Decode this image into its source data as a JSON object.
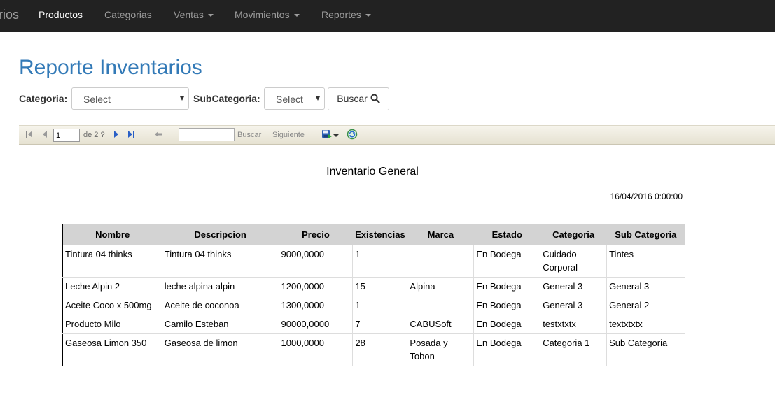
{
  "navbar": {
    "brand_fragment": "rios",
    "items": [
      {
        "label": "Productos",
        "active": true,
        "dropdown": false
      },
      {
        "label": "Categorias",
        "active": false,
        "dropdown": false
      },
      {
        "label": "Ventas",
        "active": false,
        "dropdown": true
      },
      {
        "label": "Movimientos",
        "active": false,
        "dropdown": true
      },
      {
        "label": "Reportes",
        "active": false,
        "dropdown": true
      }
    ]
  },
  "page": {
    "title": "Reporte Inventarios"
  },
  "filters": {
    "categoria_label": "Categoria:",
    "categoria_value": "Select",
    "subcategoria_label": "SubCategoria:",
    "subcategoria_value": "Select",
    "buscar_label": "Buscar"
  },
  "toolbar": {
    "current_page": "1",
    "page_of": "de 2 ?",
    "find_link": "Buscar",
    "separator": "|",
    "next_link": "Siguiente"
  },
  "report": {
    "title": "Inventario General",
    "date": "16/04/2016 0:00:00",
    "columns": [
      "Nombre",
      "Descripcion",
      "Precio",
      "Existencias",
      "Marca",
      "Estado",
      "Categoria",
      "Sub Categoria"
    ],
    "rows": [
      [
        "Tintura 04 thinks",
        "Tintura 04 thinks",
        "9000,0000",
        "1",
        "",
        "En Bodega",
        "Cuidado Corporal",
        "Tintes"
      ],
      [
        "Leche Alpin 2",
        "leche alpina alpin",
        "1200,0000",
        "15",
        "Alpina",
        "En Bodega",
        "General 3",
        "General 3"
      ],
      [
        "Aceite Coco x 500mg",
        "Aceite de coconoa",
        "1300,0000",
        "1",
        "",
        "En Bodega",
        "General 3",
        "General 2"
      ],
      [
        "Producto Milo",
        "Camilo Esteban",
        "90000,0000",
        "7",
        "CABUSoft",
        "En Bodega",
        "testxtxtx",
        "textxtxtx"
      ],
      [
        "Gaseosa Limon 350",
        "Gaseosa de limon",
        "1000,0000",
        "28",
        "Posada y Tobon",
        "En Bodega",
        "Categoria 1",
        "Sub Categoria"
      ]
    ]
  },
  "colors": {
    "navbar_bg": "#222222",
    "nav_active": "#ffffff",
    "nav_inactive": "#9d9d9d",
    "title": "#337ab7",
    "header_bg": "#d3d3d3"
  }
}
